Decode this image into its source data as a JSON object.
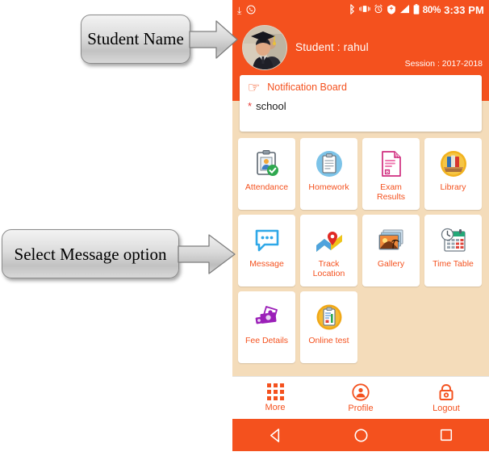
{
  "statusbar": {
    "left_icons": [
      "download-icon",
      "whatsapp-icon"
    ],
    "right_icons": [
      "bluetooth-icon",
      "vibrate-icon",
      "alarm-icon",
      "location-icon",
      "signal-icon",
      "battery-icon"
    ],
    "battery_percent": "80%",
    "time": "3:33 PM"
  },
  "header": {
    "student_label": "Student : rahul",
    "session_label": "Session : 2017-2018",
    "avatar_name": "student-avatar"
  },
  "notification": {
    "title": "Notification Board",
    "bullet": "*",
    "items": [
      "school"
    ]
  },
  "grid": {
    "rows": [
      [
        {
          "label": "Attendance",
          "icon": "attendance-icon"
        },
        {
          "label": "Homework",
          "icon": "homework-icon"
        },
        {
          "label": "Exam Results",
          "icon": "exam-results-icon"
        },
        {
          "label": "Library",
          "icon": "library-icon"
        }
      ],
      [
        {
          "label": "Message",
          "icon": "message-icon"
        },
        {
          "label": "Track Location",
          "icon": "track-location-icon"
        },
        {
          "label": "Gallery",
          "icon": "gallery-icon"
        },
        {
          "label": "Time Table",
          "icon": "time-table-icon"
        }
      ],
      [
        {
          "label": "Fee Details",
          "icon": "fee-details-icon"
        },
        {
          "label": "Online test",
          "icon": "online-test-icon"
        }
      ]
    ]
  },
  "bottomnav": [
    {
      "label": "More",
      "icon": "grid-icon"
    },
    {
      "label": "Profile",
      "icon": "person-circle-icon"
    },
    {
      "label": "Logout",
      "icon": "lock-icon"
    }
  ],
  "androidnav": [
    {
      "name": "back-button",
      "icon": "triangle-left-icon"
    },
    {
      "name": "home-button",
      "icon": "circle-icon"
    },
    {
      "name": "recents-button",
      "icon": "square-icon"
    }
  ],
  "annotations": [
    {
      "text": "Student Name"
    },
    {
      "text": "Select Message option"
    }
  ],
  "colors": {
    "brand_orange": "#f4511e",
    "peach_background": "#f4dcba",
    "label_orange": "#f4511e",
    "star_red": "#e53935"
  }
}
